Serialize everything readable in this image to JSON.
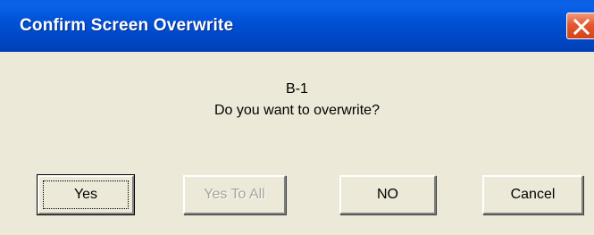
{
  "window": {
    "title": "Confirm Screen Overwrite",
    "close_icon": "close-icon"
  },
  "message": {
    "line1": "B-1",
    "line2": "Do you want to overwrite?"
  },
  "buttons": {
    "yes": "Yes",
    "yes_to_all": "Yes To All",
    "no": "NO",
    "cancel": "Cancel"
  },
  "states": {
    "yes_to_all_disabled": true,
    "default_button": "Yes"
  },
  "colors": {
    "titlebar": "#0052d6",
    "dialog_bg": "#ece9d8",
    "close_button": "#e2582f"
  }
}
